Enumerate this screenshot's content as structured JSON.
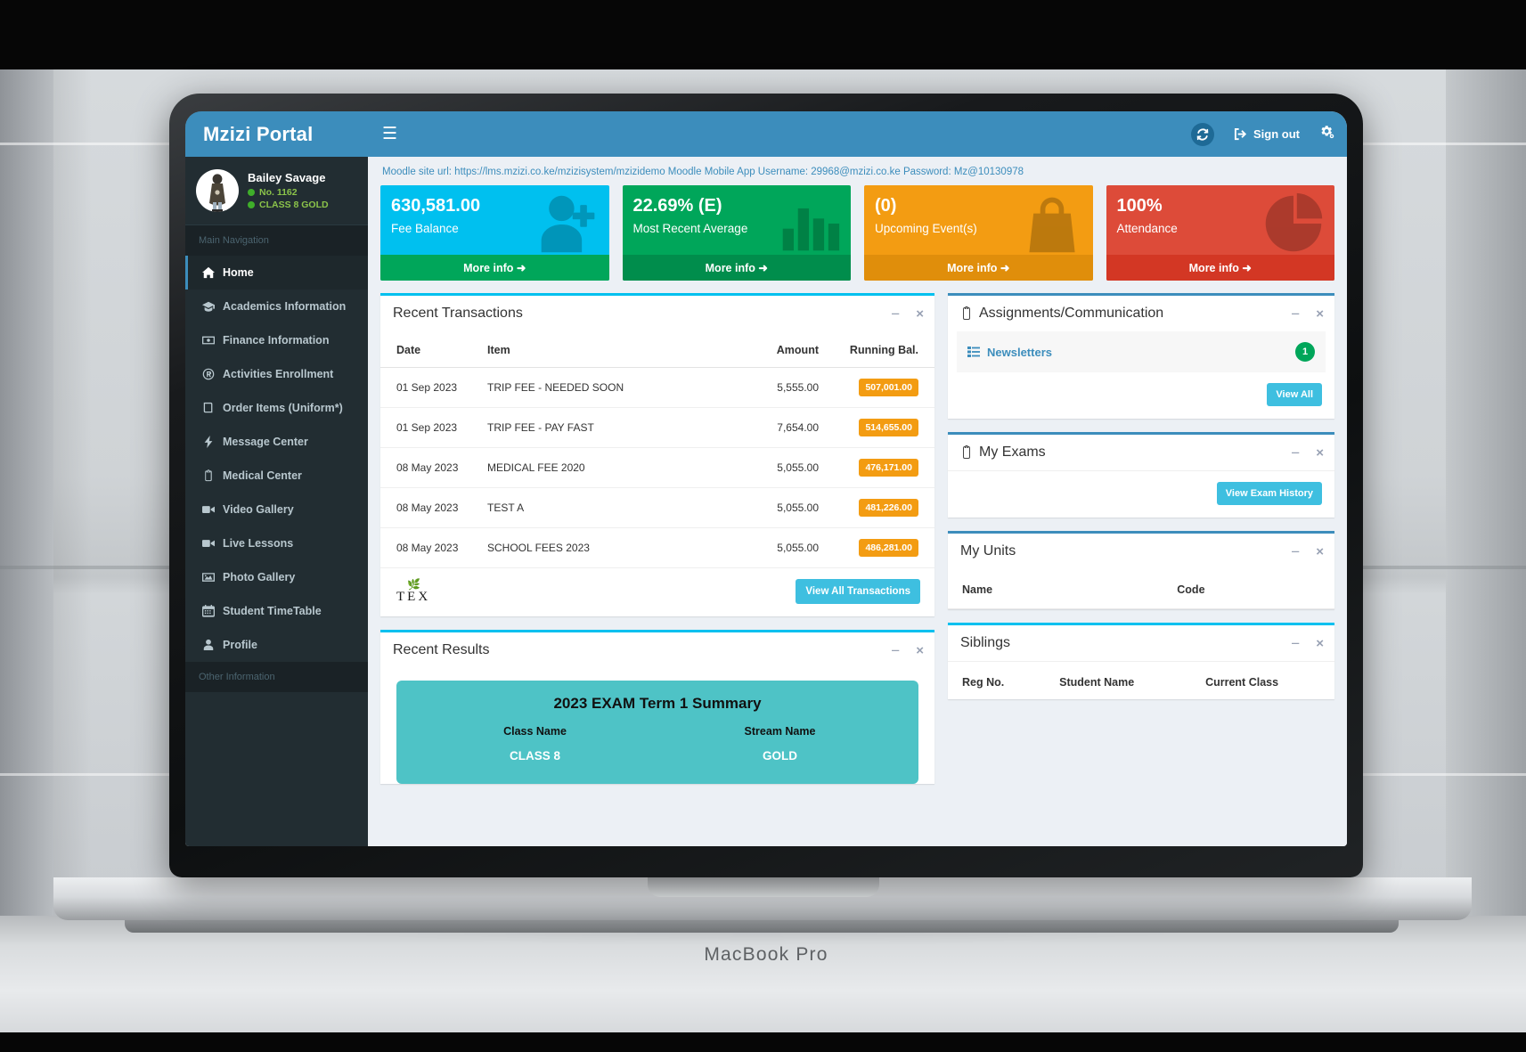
{
  "device": {
    "label": "MacBook Pro"
  },
  "brand": {
    "title": "Mzizi Portal"
  },
  "topbar": {
    "menu_icon": "hamburger-icon",
    "refresh_icon": "refresh-icon",
    "signout_label": "Sign out",
    "settings_icon": "gears-icon"
  },
  "user": {
    "name": "Bailey Savage",
    "reg": "No. 1162",
    "class": "CLASS 8 GOLD"
  },
  "sidebar": {
    "main_header": "Main Navigation",
    "other_header": "Other Information",
    "items": [
      {
        "label": "Home",
        "icon": "home-icon",
        "active": true
      },
      {
        "label": "Academics Information",
        "icon": "graduation-cap-icon",
        "active": false
      },
      {
        "label": "Finance Information",
        "icon": "money-icon",
        "active": false
      },
      {
        "label": "Activities Enrollment",
        "icon": "registered-icon",
        "active": false
      },
      {
        "label": "Order Items (Uniform*)",
        "icon": "book-icon",
        "active": false
      },
      {
        "label": "Message Center",
        "icon": "bolt-icon",
        "active": false
      },
      {
        "label": "Medical Center",
        "icon": "clipboard-icon",
        "active": false
      },
      {
        "label": "Video Gallery",
        "icon": "video-camera-icon",
        "active": false
      },
      {
        "label": "Live Lessons",
        "icon": "video-camera-icon",
        "active": false
      },
      {
        "label": "Photo Gallery",
        "icon": "photo-icon",
        "active": false
      },
      {
        "label": "Student TimeTable",
        "icon": "calendar-icon",
        "active": false
      },
      {
        "label": "Profile",
        "icon": "user-icon",
        "active": false
      }
    ]
  },
  "notice": {
    "text": "Moodle site url: https://lms.mzizi.co.ke/mzizisystem/mzizidemo Moodle Mobile App Username: 29968@mzizi.co.ke Password: Mz@10130978"
  },
  "stats": [
    {
      "value": "630,581.00",
      "label": "Fee Balance",
      "more": "More info",
      "color": "#00c0ef",
      "icon": "user-plus-icon"
    },
    {
      "value": "22.69% (E)",
      "label": "Most Recent Average",
      "more": "More info",
      "color": "#00a65a",
      "icon": "bar-chart-icon"
    },
    {
      "value": "(0)",
      "label": "Upcoming Event(s)",
      "more": "More info",
      "color": "#f39c12",
      "icon": "shopping-bag-icon"
    },
    {
      "value": "100%",
      "label": "Attendance",
      "more": "More info",
      "color": "#dd4b39",
      "icon": "pie-chart-icon"
    }
  ],
  "recent_transactions": {
    "title": "Recent Transactions",
    "columns": [
      "Date",
      "Item",
      "Amount",
      "Running Bal."
    ],
    "rows": [
      {
        "date": "01 Sep 2023",
        "item": "TRIP FEE - NEEDED SOON",
        "amount": "5,555.00",
        "balance": "507,001.00"
      },
      {
        "date": "01 Sep 2023",
        "item": "TRIP FEE - PAY FAST",
        "amount": "7,654.00",
        "balance": "514,655.00"
      },
      {
        "date": "08 May 2023",
        "item": "MEDICAL FEE 2020",
        "amount": "5,055.00",
        "balance": "476,171.00"
      },
      {
        "date": "08 May 2023",
        "item": "TEST A",
        "amount": "5,055.00",
        "balance": "481,226.00"
      },
      {
        "date": "08 May 2023",
        "item": "SCHOOL FEES 2023",
        "amount": "5,055.00",
        "balance": "486,281.00"
      }
    ],
    "watermark": "TEX",
    "view_all_label": "View All Transactions"
  },
  "recent_results": {
    "title": "Recent Results",
    "card_title": "2023 EXAM Term 1 Summary",
    "columns": [
      {
        "header": "Class Name",
        "value": "CLASS 8"
      },
      {
        "header": "Stream Name",
        "value": "GOLD"
      }
    ]
  },
  "assignments": {
    "title": "Assignments/Communication",
    "item_label": "Newsletters",
    "item_count": "1",
    "view_all_label": "View All"
  },
  "my_exams": {
    "title": "My Exams",
    "view_history_label": "View Exam History"
  },
  "my_units": {
    "title": "My Units",
    "columns": [
      "Name",
      "Code"
    ]
  },
  "siblings": {
    "title": "Siblings",
    "columns": [
      "Reg No.",
      "Student Name",
      "Current Class"
    ]
  },
  "colors": {
    "brand_blue": "#3c8dbc",
    "sidebar_dark": "#222d32",
    "aqua": "#00c0ef",
    "green": "#00a65a",
    "yellow": "#f39c12",
    "red": "#dd4b39",
    "teal_card": "#4ec3c6",
    "button_blue": "#3ebfe0"
  }
}
